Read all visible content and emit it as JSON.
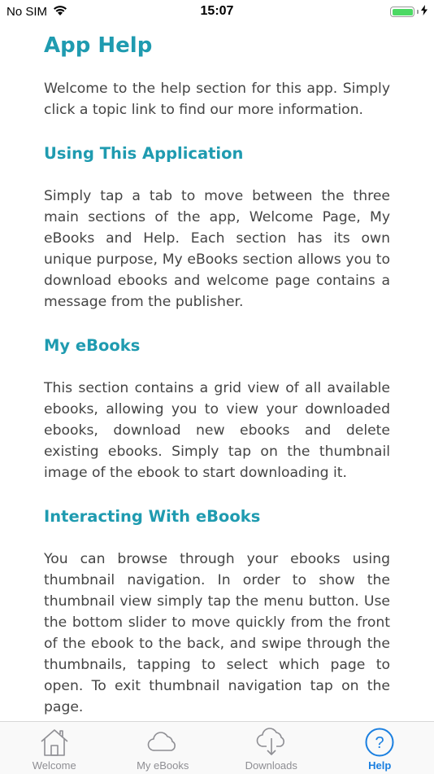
{
  "status": {
    "carrier": "No SIM",
    "time": "15:07",
    "battery_level": 1.0,
    "battery_color": "#4cd964"
  },
  "help": {
    "title": "App Help",
    "intro": "Welcome to the help section for this app. Simply click a topic link to find our more information.",
    "sections": [
      {
        "title": "Using This Application",
        "body": "Simply tap a tab to move between the three main sections of the app, Welcome Page, My eBooks and Help. Each section has its own unique purpose, My eBooks section allows you to download ebooks and welcome page contains a message from the publisher."
      },
      {
        "title": "My eBooks",
        "body": "This section contains a grid view of all available ebooks, allowing you to view your downloaded ebooks, download new ebooks and delete existing ebooks. Simply tap on the thumbnail image of the ebook to start downloading it."
      },
      {
        "title": "Interacting With eBooks",
        "body": "You can browse through your ebooks using thumbnail navigation. In order to show the thumbnail view simply tap the menu button. Use the bottom slider to move quickly from the front of the ebook to the back, and swipe through the thumbnails, tapping to select which page to open. To exit thumbnail navigation tap on the page."
      }
    ]
  },
  "tabs": [
    {
      "label": "Welcome",
      "icon": "house-icon",
      "active": false
    },
    {
      "label": "My eBooks",
      "icon": "cloud-icon",
      "active": false
    },
    {
      "label": "Downloads",
      "icon": "cloud-download-icon",
      "active": false
    },
    {
      "label": "Help",
      "icon": "help-circle-icon",
      "active": true
    }
  ],
  "colors": {
    "accent": "#1f9bb0",
    "tab_active": "#1a7fe0",
    "tab_inactive": "#8e8e93",
    "body_text": "#444444"
  }
}
